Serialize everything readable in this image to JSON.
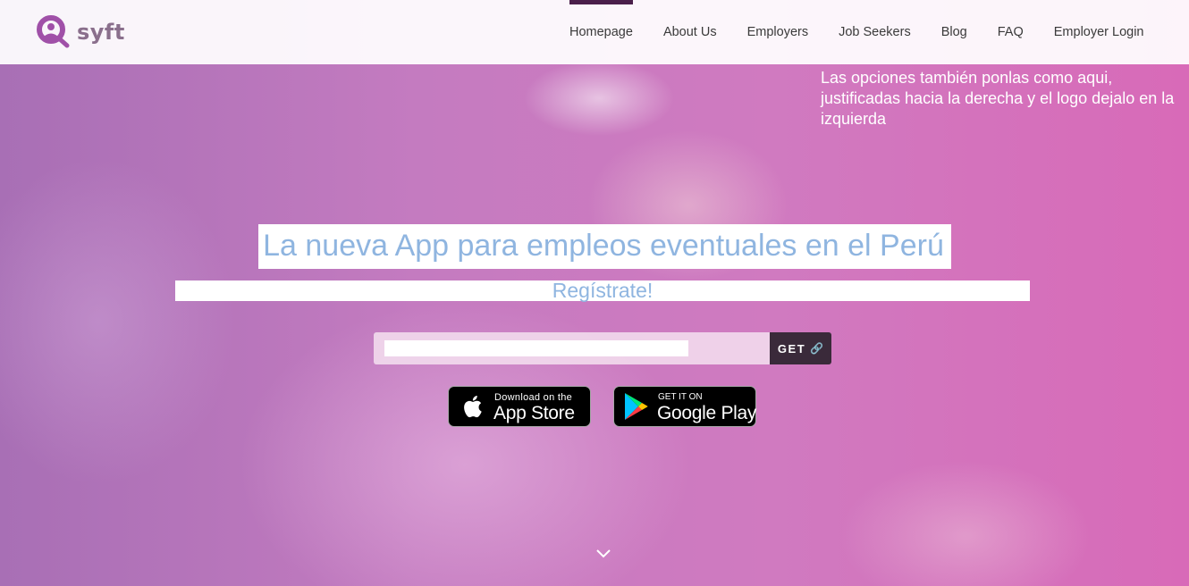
{
  "brand": {
    "name": "syft",
    "logo_color": "#a050a8"
  },
  "nav": {
    "items": [
      {
        "label": "Homepage",
        "active": true
      },
      {
        "label": "About Us"
      },
      {
        "label": "Employers"
      },
      {
        "label": "Job Seekers"
      },
      {
        "label": "Blog"
      },
      {
        "label": "FAQ"
      },
      {
        "label": "Employer Login"
      }
    ]
  },
  "note": "Las opciones también ponlas como aqui, justificadas hacia la derecha y el logo dejalo en la izquierda",
  "hero": {
    "headline": "La nueva App para empleos eventuales en el Perú",
    "subheadline": "Regístrate!",
    "headline_color": "#8fb5e0"
  },
  "signup": {
    "input_value": "",
    "button_label": "GET",
    "button_icon": "link-icon"
  },
  "badges": {
    "apple": {
      "small": "Download on the",
      "big": "App Store",
      "icon": "apple-icon"
    },
    "google": {
      "small": "GET IT ON",
      "big": "Google Play",
      "icon": "google-play-icon"
    }
  },
  "scroll_icon": "chevron-down-icon",
  "colors": {
    "overlay": "#c97ac0",
    "button": "#3a2a3a",
    "nav_active": "#4a1f4a"
  }
}
